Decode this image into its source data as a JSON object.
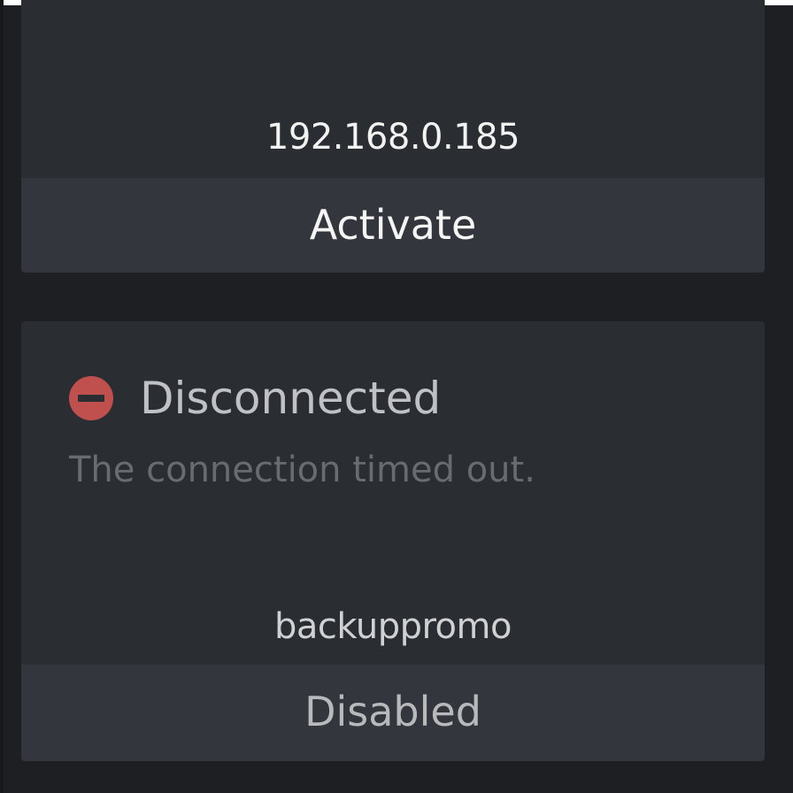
{
  "cards": [
    {
      "address": "192.168.0.185",
      "action_label": "Activate"
    },
    {
      "status": {
        "icon": "no-entry-icon",
        "label": "Disconnected",
        "detail": "The connection timed out.",
        "color": "#c0504d"
      },
      "account": "backuppromo",
      "action_label": "Disabled"
    }
  ],
  "colors": {
    "background": "#1d1f22",
    "card": "#2a2d32",
    "action_bar": "#33363c"
  }
}
